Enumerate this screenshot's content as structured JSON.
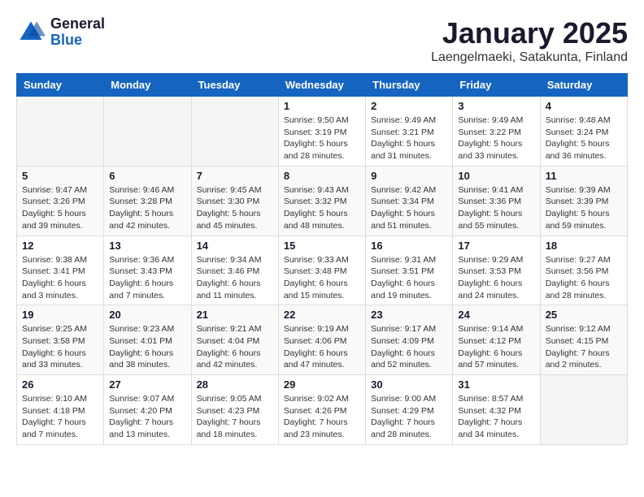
{
  "logo": {
    "general": "General",
    "blue": "Blue"
  },
  "header": {
    "month": "January 2025",
    "location": "Laengelmaeki, Satakunta, Finland"
  },
  "weekdays": [
    "Sunday",
    "Monday",
    "Tuesday",
    "Wednesday",
    "Thursday",
    "Friday",
    "Saturday"
  ],
  "weeks": [
    [
      {
        "day": "",
        "info": ""
      },
      {
        "day": "",
        "info": ""
      },
      {
        "day": "",
        "info": ""
      },
      {
        "day": "1",
        "info": "Sunrise: 9:50 AM\nSunset: 3:19 PM\nDaylight: 5 hours and 28 minutes."
      },
      {
        "day": "2",
        "info": "Sunrise: 9:49 AM\nSunset: 3:21 PM\nDaylight: 5 hours and 31 minutes."
      },
      {
        "day": "3",
        "info": "Sunrise: 9:49 AM\nSunset: 3:22 PM\nDaylight: 5 hours and 33 minutes."
      },
      {
        "day": "4",
        "info": "Sunrise: 9:48 AM\nSunset: 3:24 PM\nDaylight: 5 hours and 36 minutes."
      }
    ],
    [
      {
        "day": "5",
        "info": "Sunrise: 9:47 AM\nSunset: 3:26 PM\nDaylight: 5 hours and 39 minutes."
      },
      {
        "day": "6",
        "info": "Sunrise: 9:46 AM\nSunset: 3:28 PM\nDaylight: 5 hours and 42 minutes."
      },
      {
        "day": "7",
        "info": "Sunrise: 9:45 AM\nSunset: 3:30 PM\nDaylight: 5 hours and 45 minutes."
      },
      {
        "day": "8",
        "info": "Sunrise: 9:43 AM\nSunset: 3:32 PM\nDaylight: 5 hours and 48 minutes."
      },
      {
        "day": "9",
        "info": "Sunrise: 9:42 AM\nSunset: 3:34 PM\nDaylight: 5 hours and 51 minutes."
      },
      {
        "day": "10",
        "info": "Sunrise: 9:41 AM\nSunset: 3:36 PM\nDaylight: 5 hours and 55 minutes."
      },
      {
        "day": "11",
        "info": "Sunrise: 9:39 AM\nSunset: 3:39 PM\nDaylight: 5 hours and 59 minutes."
      }
    ],
    [
      {
        "day": "12",
        "info": "Sunrise: 9:38 AM\nSunset: 3:41 PM\nDaylight: 6 hours and 3 minutes."
      },
      {
        "day": "13",
        "info": "Sunrise: 9:36 AM\nSunset: 3:43 PM\nDaylight: 6 hours and 7 minutes."
      },
      {
        "day": "14",
        "info": "Sunrise: 9:34 AM\nSunset: 3:46 PM\nDaylight: 6 hours and 11 minutes."
      },
      {
        "day": "15",
        "info": "Sunrise: 9:33 AM\nSunset: 3:48 PM\nDaylight: 6 hours and 15 minutes."
      },
      {
        "day": "16",
        "info": "Sunrise: 9:31 AM\nSunset: 3:51 PM\nDaylight: 6 hours and 19 minutes."
      },
      {
        "day": "17",
        "info": "Sunrise: 9:29 AM\nSunset: 3:53 PM\nDaylight: 6 hours and 24 minutes."
      },
      {
        "day": "18",
        "info": "Sunrise: 9:27 AM\nSunset: 3:56 PM\nDaylight: 6 hours and 28 minutes."
      }
    ],
    [
      {
        "day": "19",
        "info": "Sunrise: 9:25 AM\nSunset: 3:58 PM\nDaylight: 6 hours and 33 minutes."
      },
      {
        "day": "20",
        "info": "Sunrise: 9:23 AM\nSunset: 4:01 PM\nDaylight: 6 hours and 38 minutes."
      },
      {
        "day": "21",
        "info": "Sunrise: 9:21 AM\nSunset: 4:04 PM\nDaylight: 6 hours and 42 minutes."
      },
      {
        "day": "22",
        "info": "Sunrise: 9:19 AM\nSunset: 4:06 PM\nDaylight: 6 hours and 47 minutes."
      },
      {
        "day": "23",
        "info": "Sunrise: 9:17 AM\nSunset: 4:09 PM\nDaylight: 6 hours and 52 minutes."
      },
      {
        "day": "24",
        "info": "Sunrise: 9:14 AM\nSunset: 4:12 PM\nDaylight: 6 hours and 57 minutes."
      },
      {
        "day": "25",
        "info": "Sunrise: 9:12 AM\nSunset: 4:15 PM\nDaylight: 7 hours and 2 minutes."
      }
    ],
    [
      {
        "day": "26",
        "info": "Sunrise: 9:10 AM\nSunset: 4:18 PM\nDaylight: 7 hours and 7 minutes."
      },
      {
        "day": "27",
        "info": "Sunrise: 9:07 AM\nSunset: 4:20 PM\nDaylight: 7 hours and 13 minutes."
      },
      {
        "day": "28",
        "info": "Sunrise: 9:05 AM\nSunset: 4:23 PM\nDaylight: 7 hours and 18 minutes."
      },
      {
        "day": "29",
        "info": "Sunrise: 9:02 AM\nSunset: 4:26 PM\nDaylight: 7 hours and 23 minutes."
      },
      {
        "day": "30",
        "info": "Sunrise: 9:00 AM\nSunset: 4:29 PM\nDaylight: 7 hours and 28 minutes."
      },
      {
        "day": "31",
        "info": "Sunrise: 8:57 AM\nSunset: 4:32 PM\nDaylight: 7 hours and 34 minutes."
      },
      {
        "day": "",
        "info": ""
      }
    ]
  ]
}
